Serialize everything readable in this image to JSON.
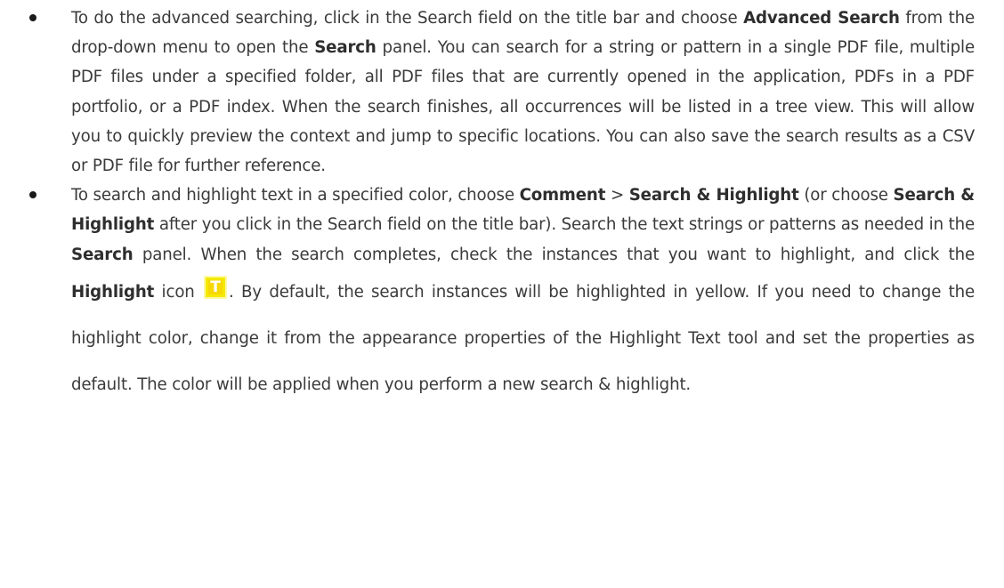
{
  "items": [
    {
      "segments": [
        "To do the advanced searching, click in the Search field on the title bar and choose ",
        "Advanced Search",
        " from the drop-down menu to open the ",
        "Search",
        " panel. You can search for a string or pattern in a single PDF file, multiple PDF files under a specified folder, all PDF files that are currently opened in the application, PDFs in a PDF portfolio, or a PDF index. When the search finishes, all occurrences will be listed in a tree view. This will allow you to quickly preview the context and jump to specific locations. You can also save the search results as a CSV or PDF file for further reference."
      ]
    },
    {
      "segments": [
        "To search and highlight text in a specified color, choose ",
        "Comment",
        " > ",
        "Search & Highlight",
        " (or choose ",
        "Search & Highlight",
        " after you click in the Search field on the title bar). Search the text strings or patterns as needed in the ",
        "Search",
        " panel. When the search completes, check the instances that you want to highlight, and click the ",
        "Highlight",
        " icon ",
        ". By default, the search instances will be highlighted in yellow. If you need to change the highlight color, change it from the appearance properties of the Highlight Text tool and set the properties as default. The color will be applied when you perform a new search & highlight."
      ],
      "icon_letter": "T",
      "icon_name": "highlight-icon"
    }
  ],
  "colors": {
    "text": "#3a3a3a",
    "highlight_icon": "#f5e800"
  }
}
